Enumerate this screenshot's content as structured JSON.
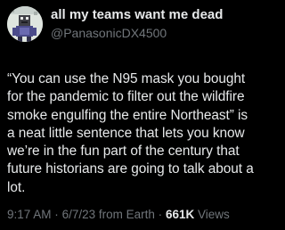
{
  "tweet": {
    "author": {
      "display_name": "all my teams want me dead",
      "handle": "@PanasonicDX4500",
      "avatar_icon": "profile-avatar"
    },
    "text_lines": [
      "“You can use the N95 mask you bought",
      "for the pandemic to filter out the wildfire",
      "smoke engulfing the entire Northeast” is",
      "a neat little sentence that lets you know",
      "we’re in the fun part of the century that",
      "future historians are going to talk about a",
      "lot."
    ],
    "meta": {
      "time": "9:17 AM",
      "separator": "·",
      "date": "6/7/23",
      "source": "from Earth",
      "views_count": "661K",
      "views_label": "Views"
    }
  },
  "colors": {
    "background": "#000000",
    "primary_text": "#e7e9ea",
    "secondary_text": "#71767b"
  }
}
